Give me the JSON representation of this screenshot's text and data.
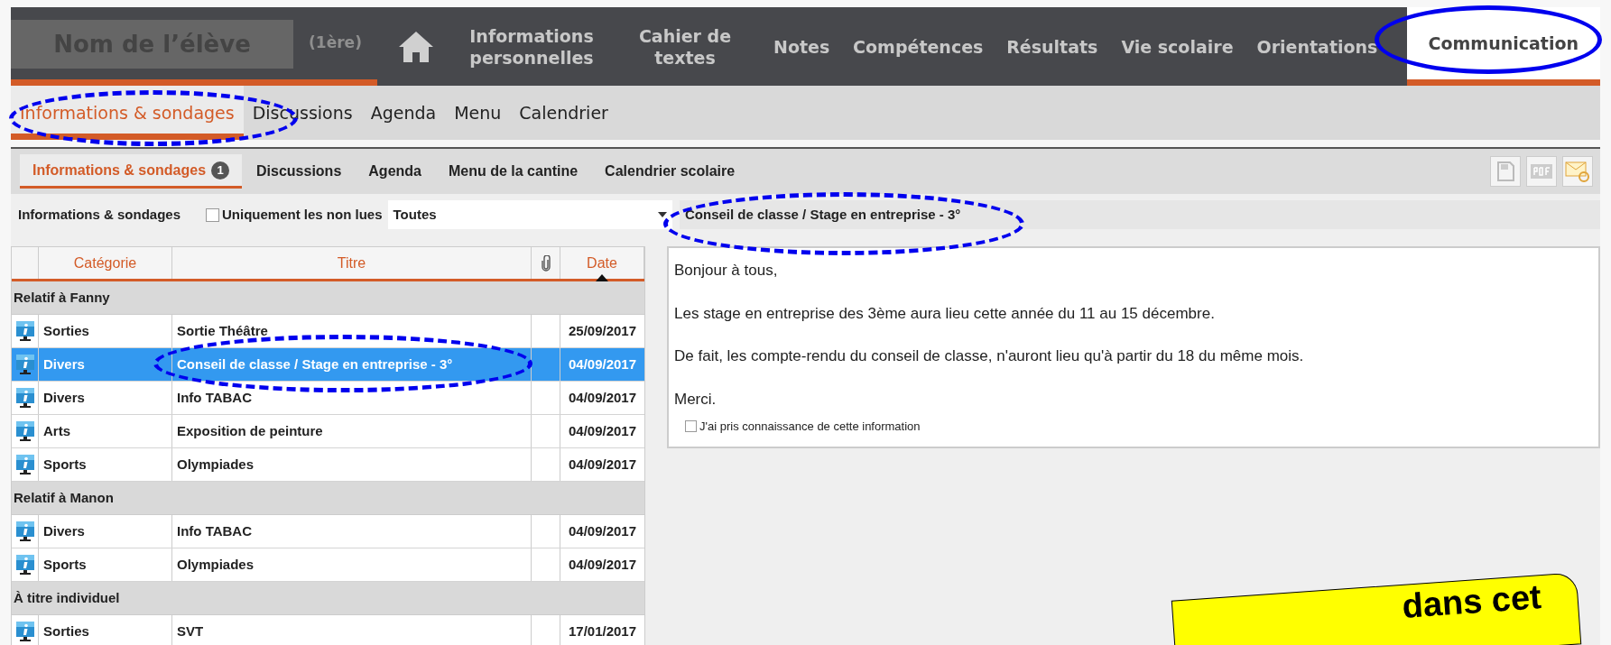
{
  "student": {
    "name": "Nom de l’élève",
    "class": "(1ère)"
  },
  "main_nav": [
    {
      "kind": "home",
      "selected": false
    },
    {
      "kind": "text",
      "label": "Informations personnelles",
      "selected": false
    },
    {
      "kind": "text",
      "label": "Cahier de textes",
      "selected": false
    },
    {
      "kind": "text",
      "label": "Notes",
      "selected": false
    },
    {
      "kind": "text",
      "label": "Compétences",
      "selected": false
    },
    {
      "kind": "text",
      "label": "Résultats",
      "selected": false
    },
    {
      "kind": "text",
      "label": "Vie scolaire",
      "selected": false
    },
    {
      "kind": "text",
      "label": "Orientations",
      "selected": false
    },
    {
      "kind": "text",
      "label": "Communication",
      "selected": true
    }
  ],
  "sub_nav": [
    {
      "label": "Informations & sondages",
      "selected": true
    },
    {
      "label": "Discussions",
      "selected": false
    },
    {
      "label": "Agenda",
      "selected": false
    },
    {
      "label": "Menu",
      "selected": false
    },
    {
      "label": "Calendrier",
      "selected": false
    }
  ],
  "tabs": [
    {
      "label": "Informations & sondages",
      "selected": true,
      "badge": "1"
    },
    {
      "label": "Discussions",
      "selected": false
    },
    {
      "label": "Agenda",
      "selected": false
    },
    {
      "label": "Menu de la cantine",
      "selected": false
    },
    {
      "label": "Calendrier scolaire",
      "selected": false
    }
  ],
  "filter": {
    "label": "Informations & sondages",
    "unread_only": {
      "label": "Uniquement les non lues",
      "checked": false
    },
    "select": {
      "value": "Toutes"
    }
  },
  "table": {
    "columns": [
      {
        "kind": "text",
        "label": "Catégorie"
      },
      {
        "kind": "text",
        "label": "Titre"
      },
      {
        "kind": "attachment"
      },
      {
        "kind": "text",
        "label": "Date",
        "sorted": true
      }
    ],
    "groups": [
      {
        "label": "Relatif à Fanny",
        "rows": [
          {
            "category": "Sorties",
            "title": "Sortie Théâtre",
            "date": "25/09/2017",
            "selected": false
          },
          {
            "category": "Divers",
            "title": "Conseil de classe / Stage en entreprise - 3°",
            "date": "04/09/2017",
            "selected": true
          },
          {
            "category": "Divers",
            "title": "Info TABAC",
            "date": "04/09/2017",
            "selected": false
          },
          {
            "category": "Arts",
            "title": "Exposition de peinture",
            "date": "04/09/2017",
            "selected": false
          },
          {
            "category": "Sports",
            "title": "Olympiades",
            "date": "04/09/2017",
            "selected": false
          }
        ]
      },
      {
        "label": "Relatif à Manon",
        "rows": [
          {
            "category": "Divers",
            "title": "Info TABAC",
            "date": "04/09/2017",
            "selected": false
          },
          {
            "category": "Sports",
            "title": "Olympiades",
            "date": "04/09/2017",
            "selected": false
          }
        ]
      },
      {
        "label": "À titre individuel",
        "rows": [
          {
            "category": "Sorties",
            "title": "SVT",
            "date": "17/01/2017",
            "selected": false
          }
        ]
      }
    ]
  },
  "message": {
    "title": "Conseil de classe / Stage en entreprise - 3°",
    "paragraphs": [
      "Bonjour à tous,",
      "Les stage en entreprise des 3ème aura lieu cette année du 11 au 15 décembre.",
      "De fait, les compte-rendu du conseil de classe, n'auront lieu qu'à partir du 18 du même mois.",
      "Merci."
    ],
    "acknowledge": {
      "label": "J'ai pris connaissance de cette information",
      "checked": false
    }
  },
  "callout": {
    "text": "dans cet"
  }
}
